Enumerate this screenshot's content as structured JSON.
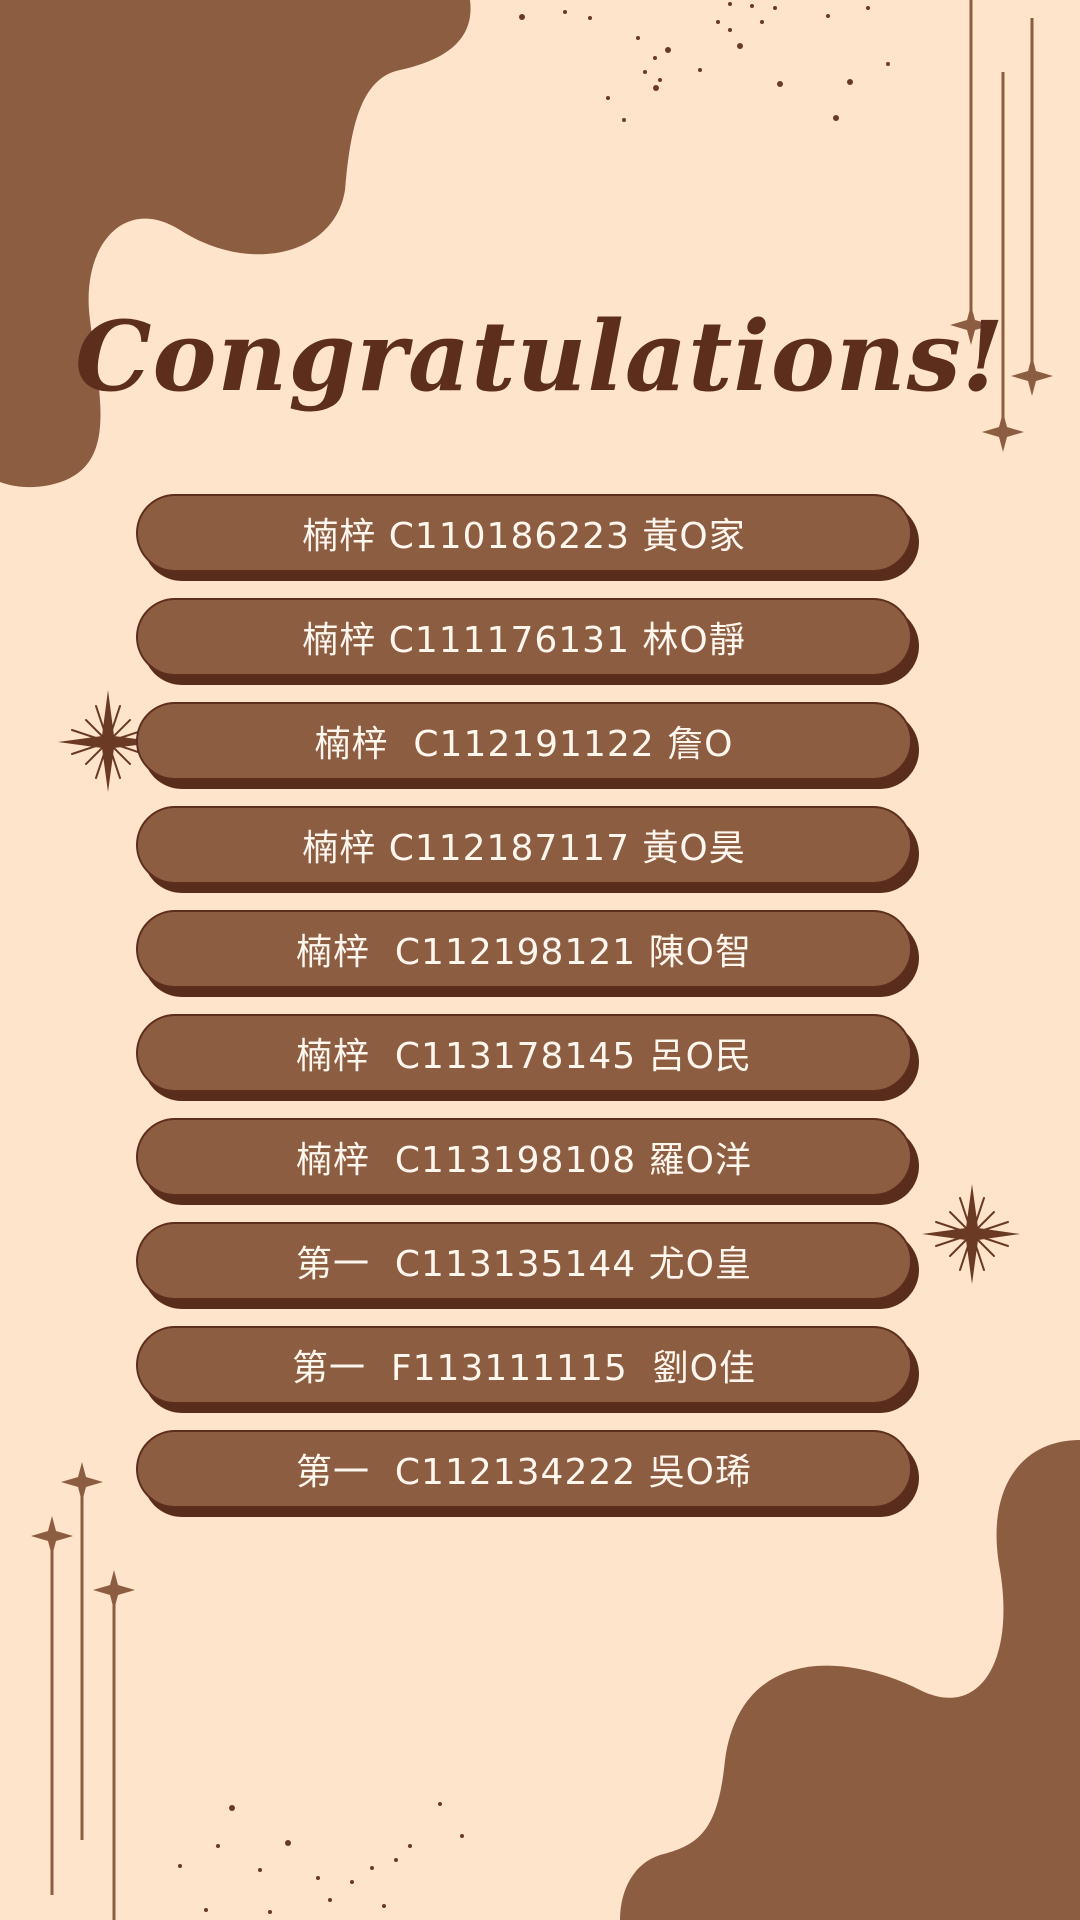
{
  "title": "Congratulations!",
  "colors": {
    "background": "#FEE4CB",
    "accent_brown": "#8D5D42",
    "dark_brown": "#5E2E1C",
    "text_light": "#FFF6EE"
  },
  "entries": [
    "楠梓 C110186223 黃O家",
    "楠梓 C111176131 林O靜",
    "楠梓  C112191122 詹O",
    "楠梓 C112187117 黃O昊",
    "楠梓  C112198121 陳O智",
    "楠梓  C113178145 呂O民",
    "楠梓  C113198108 羅O洋",
    "第一  C113135144 尤O皇",
    "第一  F113111115  劉O佳",
    "第一  C112134222 吳O琋"
  ]
}
